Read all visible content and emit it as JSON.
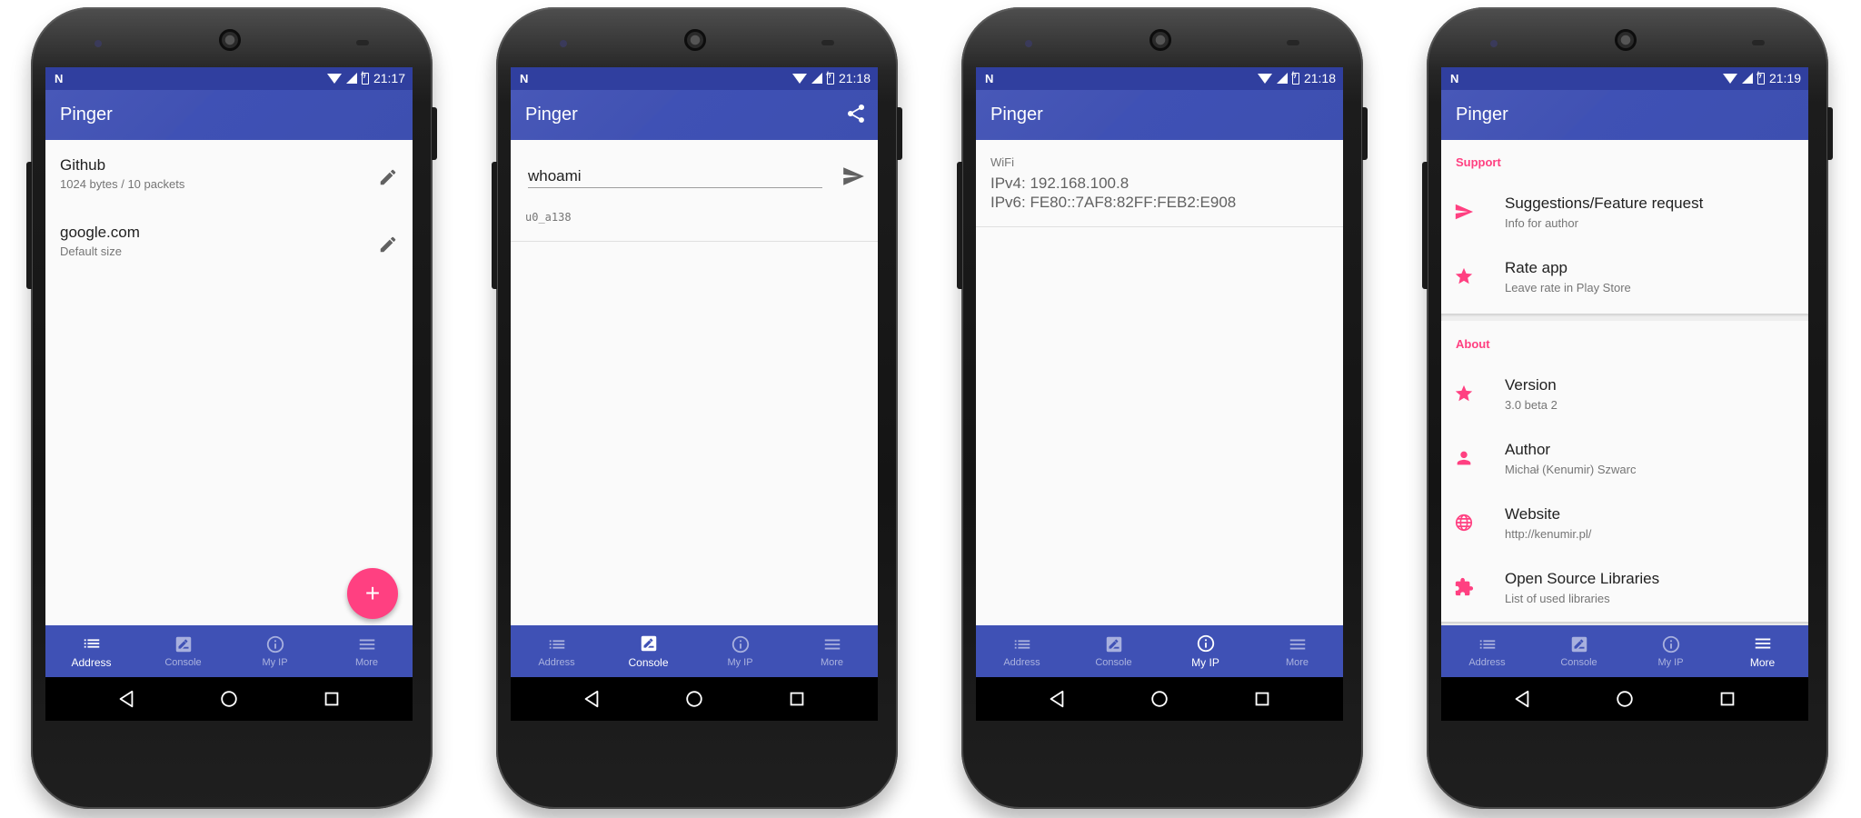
{
  "colors": {
    "primary": "#3f51b5",
    "primary_dark": "#303f9f",
    "accent": "#ff4081"
  },
  "nav": {
    "address": "Address",
    "console": "Console",
    "myip": "My IP",
    "more": "More"
  },
  "app_title": "Pinger",
  "phones": [
    {
      "time": "21:17"
    },
    {
      "time": "21:18"
    },
    {
      "time": "21:18"
    },
    {
      "time": "21:19"
    }
  ],
  "address": {
    "items": [
      {
        "title": "Github",
        "subtitle": "1024 bytes / 10 packets"
      },
      {
        "title": "google.com",
        "subtitle": "Default size"
      }
    ],
    "fab_label": "+"
  },
  "console": {
    "command": "whoami",
    "output": "u0_a138"
  },
  "myip": {
    "label": "WiFi",
    "ipv4": "IPv4: 192.168.100.8",
    "ipv6": "IPv6: FE80::7AF8:82FF:FEB2:E908"
  },
  "more": {
    "support_header": "Support",
    "about_header": "About",
    "support_items": [
      {
        "title": "Suggestions/Feature request",
        "subtitle": "Info for author",
        "icon": "send-icon"
      },
      {
        "title": "Rate app",
        "subtitle": "Leave rate in Play Store",
        "icon": "star-icon"
      }
    ],
    "about_items": [
      {
        "title": "Version",
        "subtitle": "3.0 beta 2",
        "icon": "star-icon"
      },
      {
        "title": "Author",
        "subtitle": "Michał (Kenumir) Szwarc",
        "icon": "person-icon"
      },
      {
        "title": "Website",
        "subtitle": "http://kenumir.pl/",
        "icon": "globe-icon"
      },
      {
        "title": "Open Source Libraries",
        "subtitle": "List of used libraries",
        "icon": "puzzle-icon"
      }
    ]
  }
}
